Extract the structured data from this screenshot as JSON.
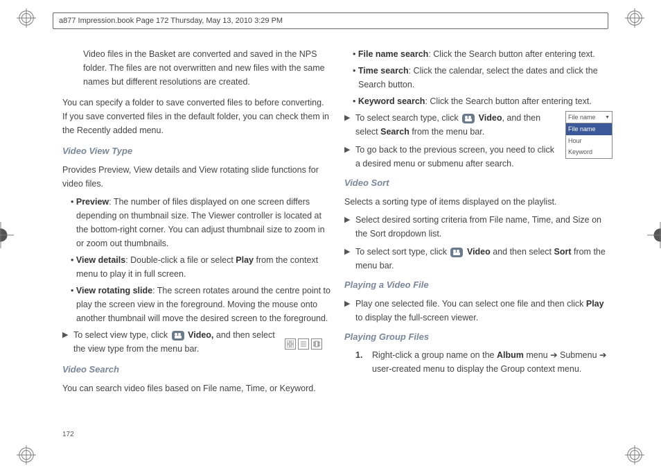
{
  "header": {
    "text": "a877 Impression.book  Page 172  Thursday, May 13, 2010  3:29 PM"
  },
  "page_number": "172",
  "left": {
    "intro_continue": "Video files in the Basket are converted and saved in the NPS folder. The files are not overwritten and new files with the same names but different resolutions are created.",
    "intro_flush": "You can specify a folder to save converted files to before converting. If you save converted files in the default folder, you can check them in the Recently added menu.",
    "video_view_type": {
      "heading": "Video View Type",
      "desc": "Provides Preview, View details and View rotating slide functions for video files.",
      "preview_label": "Preview",
      "preview_text": ": The number of files displayed on one screen differs depending on thumbnail size. The Viewer controller is located at the bottom-right corner. You can adjust thumbnail size to zoom in or zoom out thumbnails.",
      "viewdetails_label": "View details",
      "viewdetails_pre": ": Double-click a file or select ",
      "viewdetails_bold": "Play",
      "viewdetails_post": " from the context menu to play it in full screen.",
      "rotate_label": "View rotating slide",
      "rotate_text": ": The screen rotates around the centre point to play the screen view in the foreground. Moving the mouse onto another thumbnail will move the desired screen to the foreground.",
      "select_pre": "To select view type, click ",
      "select_bold": "Video,",
      "select_post": " and then select the view type  from the menu bar."
    },
    "video_search": {
      "heading": "Video Search",
      "desc": "You can search video files based on File name, Time, or Keyword."
    }
  },
  "right": {
    "filename_label": "File name search",
    "filename_text": ": Click the Search button after entering text.",
    "time_label": "Time search",
    "time_text": ": Click the calendar, select the dates and click the Search button.",
    "keyword_label": "Keyword search",
    "keyword_text": ": Click the Search button after entering text.",
    "select_search_pre": "To select search type, click ",
    "select_search_bold1": "Video",
    "select_search_mid": ", and then select ",
    "select_search_bold2": "Search",
    "select_search_post": "  from the menu bar.",
    "goback": "To go back to the previous screen, you need to click a desired menu or submenu after search.",
    "video_sort": {
      "heading": "Video Sort",
      "desc": "Selects a sorting type of items displayed on the playlist.",
      "criteria": "Select desired sorting criteria from File name, Time, and Size on the Sort dropdown list.",
      "select_pre": "To select sort type, click ",
      "select_bold1": "Video",
      "select_mid": " and then select ",
      "select_bold2": "Sort",
      "select_post": " from the menu bar."
    },
    "playing_video": {
      "heading": "Playing a Video File",
      "pre": "Play one selected file. You can select one file and then click ",
      "bold": "Play",
      "post": " to display the full-screen viewer."
    },
    "playing_group": {
      "heading": "Playing Group Files",
      "num": "1.",
      "pre": "Right-click a group name on the ",
      "bold": "Album",
      "mid": " menu  ➔ Submenu ➔ user-created menu to display the Group context menu."
    },
    "dropdown": {
      "head": "File name",
      "opt1": "File name",
      "opt2": "Hour",
      "opt3": "Keyword"
    }
  }
}
